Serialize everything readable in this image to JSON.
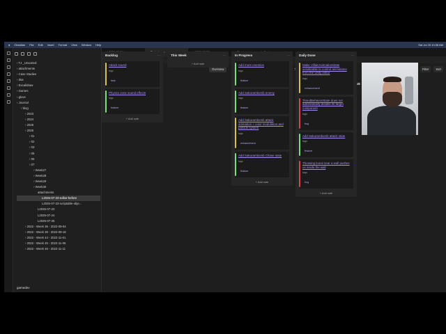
{
  "menubar": {
    "app": "Obsidian",
    "items": [
      "File",
      "Edit",
      "Insert",
      "Format",
      "View",
      "Window",
      "Help"
    ],
    "clock": "Sat Jul 25  10:38 AM"
  },
  "sidebar": {
    "tree": [
      {
        "label": "TJ _Unsorted",
        "indent": 0
      },
      {
        "label": "attachments",
        "indent": 0
      },
      {
        "label": "Case Studies",
        "indent": 0
      },
      {
        "label": "dsa",
        "indent": 0
      },
      {
        "label": "Excalidraw",
        "indent": 0
      },
      {
        "label": "Games",
        "indent": 0
      },
      {
        "label": "glove",
        "indent": 0
      },
      {
        "label": "Journal",
        "indent": 0
      },
      {
        "label": "blog",
        "indent": 1
      },
      {
        "label": "2023",
        "indent": 2
      },
      {
        "label": "2024",
        "indent": 2
      },
      {
        "label": "2025",
        "indent": 2
      },
      {
        "label": "2026",
        "indent": 2
      },
      {
        "label": "01",
        "indent": 3
      },
      {
        "label": "02",
        "indent": 3
      },
      {
        "label": "03",
        "indent": 3
      },
      {
        "label": "05",
        "indent": 3
      },
      {
        "label": "06",
        "indent": 3
      },
      {
        "label": "07",
        "indent": 3
      },
      {
        "label": "Week27",
        "indent": 4
      },
      {
        "label": "Week28",
        "indent": 4
      },
      {
        "label": "Week29",
        "indent": 4
      },
      {
        "label": "Week30",
        "indent": 4
      },
      {
        "label": "attachments",
        "indent": 5
      },
      {
        "label": "L2026-07-23-editor-before",
        "indent": 6
      },
      {
        "label": "L2026-07-23-scriptable-obje...",
        "indent": 6
      },
      {
        "label": "L2026-07-23",
        "indent": 5
      },
      {
        "label": "L2026-07-24",
        "indent": 5
      },
      {
        "label": "L2026-07-25",
        "indent": 5
      },
      {
        "label": "2022 - Week 36 - 2022-09-04",
        "indent": 2
      },
      {
        "label": "2022 - Week 38 - 2022-09-18",
        "indent": 2
      },
      {
        "label": "2022 - Week 44 - 2022-11-01",
        "indent": 2
      },
      {
        "label": "2022 - Week 45 - 2022-11-06",
        "indent": 2
      },
      {
        "label": "2022 - Week 46 - 2022-11-11",
        "indent": 2
      }
    ],
    "vault_name": "gamedev"
  },
  "tabs": [
    {
      "label": "L2026-07-24",
      "active": false
    },
    {
      "label": "Projects",
      "active": true
    },
    {
      "label": "L2026-07-23",
      "active": false
    },
    {
      "label": "Physics zone sound effects",
      "active": false
    }
  ],
  "viewbar": {
    "title": "Projects"
  },
  "toolbar": {
    "board": "Sharinja",
    "views": [
      "Overview",
      "Dev Board",
      "Design Board",
      "Sound",
      "Table"
    ],
    "active_view": "Overview",
    "filter": "Filter",
    "sort": "Sort",
    "status_label": "Status"
  },
  "columns": [
    {
      "title": "Backlog",
      "cards": [
        {
          "title": "Attack sound",
          "tag": "task",
          "color": "#d8c24a"
        },
        {
          "title": "Physics zone sound effects",
          "tag": "feature",
          "color": "#7adf7a"
        }
      ]
    },
    {
      "title": "This Week",
      "cards": []
    },
    {
      "title": "In Progress",
      "cards": [
        {
          "title": "Add more enemies",
          "tag": "feature",
          "color": "#7adf7a"
        },
        {
          "title": "Add Sakurambomb enemy",
          "tag": "feature",
          "color": "#7adf7a"
        },
        {
          "title": "Add Sakurambomb attack animation + color modulation and particle system",
          "tag": "enhancement",
          "color": "#d8c24a"
        },
        {
          "title": "Add Sakurambomb Chase state",
          "tag": "feature",
          "color": "#7adf7a"
        }
      ]
    },
    {
      "title": "Daily Done",
      "cards": [
        {
          "title": "Make VillainAnimationState serializable to control animations from the Unity editor",
          "tag": "enhancement",
          "color": "#d8c24a"
        },
        {
          "title": "TimedBehaviorState does not automatically disable its target component",
          "tag": "bug",
          "color": "#d8454a"
        },
        {
          "title": "Add Sakurambomb attack state",
          "tag": "feature",
          "color": "#7adf7a"
        },
        {
          "title": "Throwing kunai near a wall pushes us inside the wall",
          "tag": "bug",
          "color": "#d8454a"
        }
      ]
    }
  ],
  "add_note_label": "+ Add note",
  "tags_label": "tags"
}
